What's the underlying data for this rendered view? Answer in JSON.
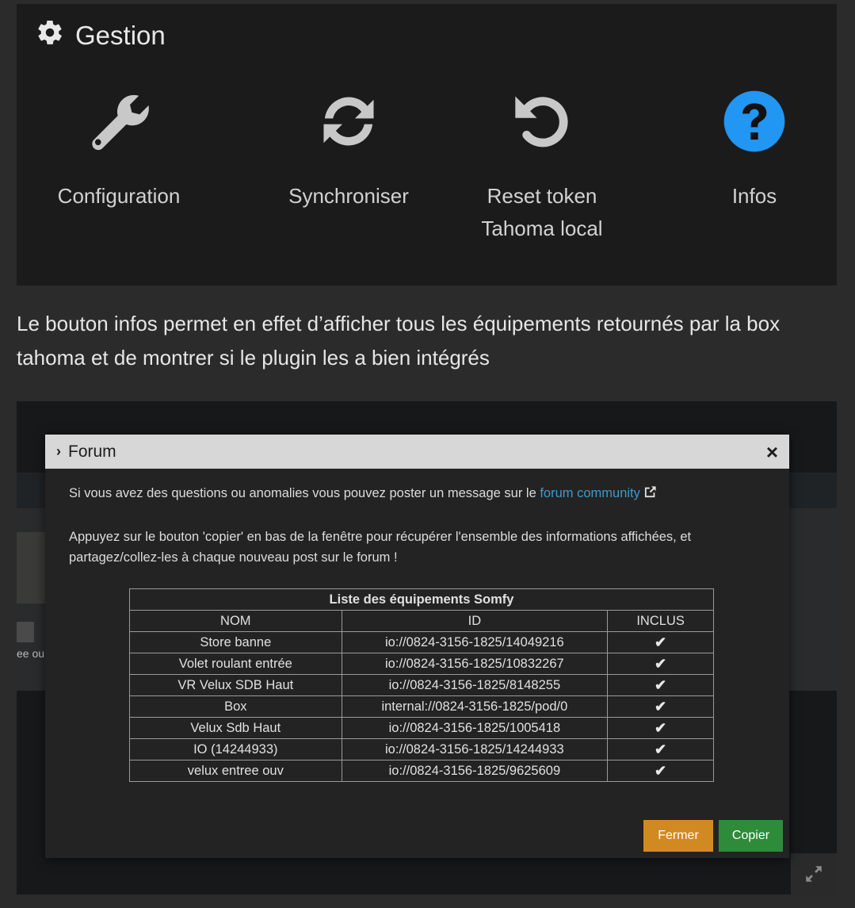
{
  "gestion": {
    "title": "Gestion",
    "actions": [
      {
        "label": "Configuration",
        "icon": "wrench-icon"
      },
      {
        "label": "Synchroniser",
        "icon": "sync-icon"
      },
      {
        "label": "Reset token\nTahoma local",
        "icon": "undo-icon"
      },
      {
        "label": "Infos",
        "icon": "question-circle-icon"
      }
    ]
  },
  "paragraph": "Le bouton infos permet en effet d’afficher tous les équipements retournés par la box tahoma et de montrer si le plugin les a bien intégrés",
  "background": {
    "partial_text": "ee ou"
  },
  "modal": {
    "title": "Forum",
    "close_label": "×",
    "intro_before_link": "Si vous avez des questions ou anomalies vous pouvez poster un message sur le ",
    "link_text": "forum community",
    "instructions": "Appuyez sur le bouton 'copier' en bas de la fenêtre pour récupérer l'ensemble des informations affichées, et partagez/collez-les à chaque nouveau post sur le forum !",
    "table": {
      "caption": "Liste des équipements Somfy",
      "headers": [
        "NOM",
        "ID",
        "INCLUS"
      ],
      "rows": [
        {
          "nom": "Store banne",
          "id": "io://0824-3156-1825/14049216",
          "inclus": "✔"
        },
        {
          "nom": "Volet roulant entrée",
          "id": "io://0824-3156-1825/10832267",
          "inclus": "✔"
        },
        {
          "nom": "VR Velux SDB Haut",
          "id": "io://0824-3156-1825/8148255",
          "inclus": "✔"
        },
        {
          "nom": "Box",
          "id": "internal://0824-3156-1825/pod/0",
          "inclus": "✔"
        },
        {
          "nom": "Velux Sdb Haut",
          "id": "io://0824-3156-1825/1005418",
          "inclus": "✔"
        },
        {
          "nom": "IO (14244933)",
          "id": "io://0824-3156-1825/14244933",
          "inclus": "✔"
        },
        {
          "nom": "velux entree ouv",
          "id": "io://0824-3156-1825/9625609",
          "inclus": "✔"
        }
      ]
    },
    "buttons": {
      "fermer": "Fermer",
      "copier": "Copier"
    }
  },
  "colors": {
    "info_blue": "#2196f3",
    "link_blue": "#3a9bd6",
    "fermer_orange": "#d18a22",
    "copier_green": "#2e8b3a"
  }
}
